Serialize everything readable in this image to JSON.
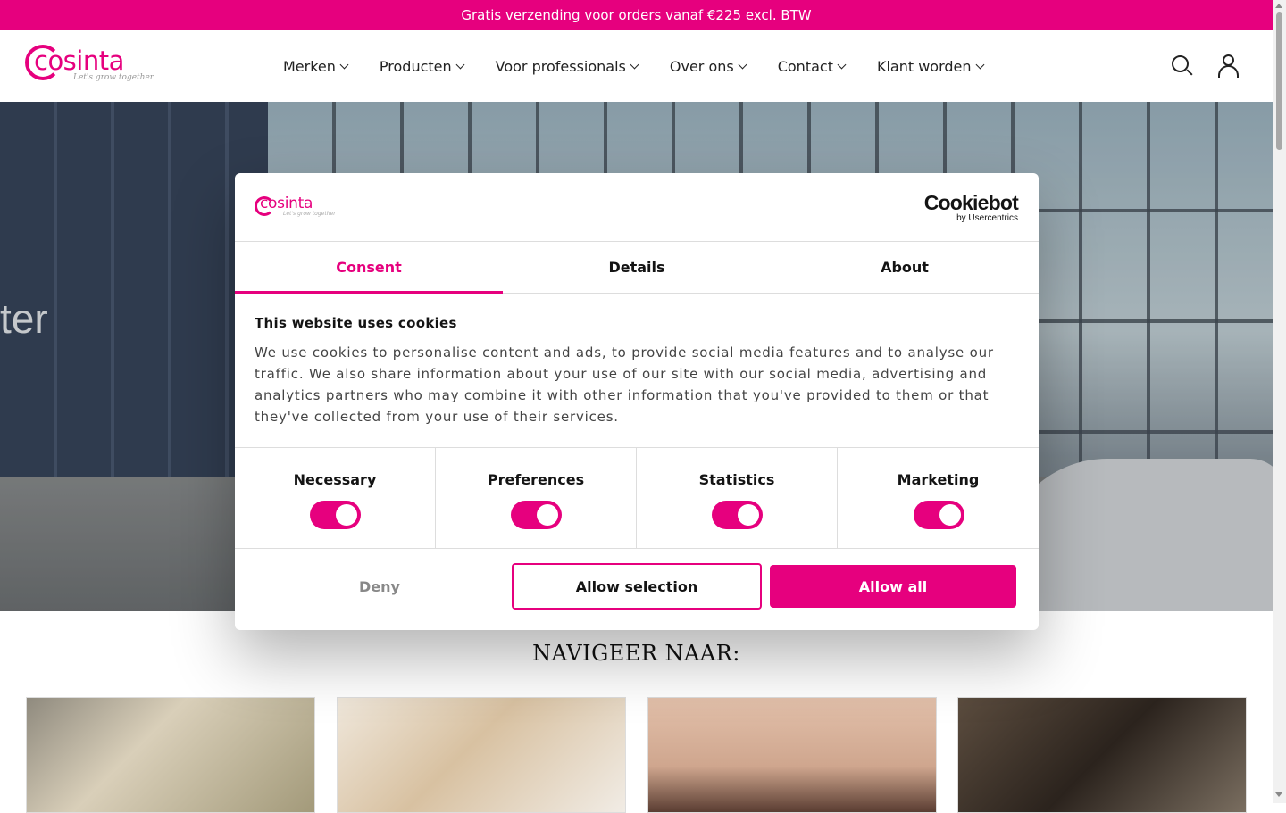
{
  "topbar": {
    "text": "Gratis verzending voor orders vanaf €225 excl. BTW"
  },
  "header": {
    "logo_text": "cosinta",
    "logo_tagline": "Let's grow together",
    "nav": [
      {
        "label": "Merken"
      },
      {
        "label": "Producten"
      },
      {
        "label": "Voor professionals"
      },
      {
        "label": "Over ons"
      },
      {
        "label": "Contact"
      },
      {
        "label": "Klant worden"
      }
    ],
    "icons": {
      "search": "search-icon",
      "account": "user-icon"
    }
  },
  "hero": {
    "sign_text": "ter"
  },
  "section": {
    "title": "NAVIGEER NAAR:"
  },
  "cookie_dialog": {
    "logo_text": "cosinta",
    "logo_tagline": "Let's grow together",
    "brand_name": "Cookiebot",
    "brand_sub": "by Usercentrics",
    "tabs": [
      {
        "label": "Consent",
        "active": true
      },
      {
        "label": "Details",
        "active": false
      },
      {
        "label": "About",
        "active": false
      }
    ],
    "title": "This website uses cookies",
    "body": "We use cookies to personalise content and ads, to provide social media features and to analyse our traffic. We also share information about your use of our site with our social media, advertising and analytics partners who may combine it with other information that you've provided to them or that they've collected from your use of their services.",
    "toggles": [
      {
        "label": "Necessary",
        "on": true
      },
      {
        "label": "Preferences",
        "on": true
      },
      {
        "label": "Statistics",
        "on": true
      },
      {
        "label": "Marketing",
        "on": true
      }
    ],
    "buttons": {
      "deny": "Deny",
      "allow_selection": "Allow selection",
      "allow_all": "Allow all"
    }
  },
  "colors": {
    "accent": "#e6007e",
    "text": "#141414"
  }
}
